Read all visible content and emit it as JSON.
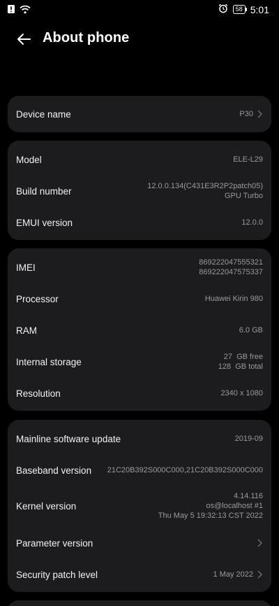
{
  "status_bar": {
    "time": "5:01",
    "battery": "58",
    "icons_left": [
      "alert-icon",
      "wifi-icon"
    ],
    "icons_right": [
      "alarm-icon",
      "battery-icon"
    ]
  },
  "header": {
    "title": "About phone",
    "back_icon": "arrow-left-icon"
  },
  "cards": [
    {
      "rows": [
        {
          "label": "Device name",
          "value": "P30",
          "chevron": true
        }
      ]
    },
    {
      "rows": [
        {
          "label": "Model",
          "value": "ELE-L29"
        },
        {
          "label": "Build number",
          "value_lines": [
            "12.0.0.134(C431E3R2P2patch05)",
            "GPU Turbo"
          ]
        },
        {
          "label": "EMUI version",
          "value": "12.0.0"
        }
      ]
    },
    {
      "rows": [
        {
          "label": "IMEI",
          "value_lines": [
            "869222047555321",
            "869222047575337"
          ]
        },
        {
          "label": "Processor",
          "value": "Huawei Kirin 980"
        },
        {
          "label": "RAM",
          "value": "6.0 GB"
        },
        {
          "label": "Internal storage",
          "value_lines": [
            "27  GB free",
            "128  GB total"
          ]
        },
        {
          "label": "Resolution",
          "value": "2340 x 1080"
        }
      ]
    },
    {
      "rows": [
        {
          "label": "Mainline software update",
          "value": "2019-09"
        },
        {
          "label": "Baseband version",
          "value": "21C20B392S000C000,21C20B392S000C000"
        },
        {
          "label": "Kernel version",
          "value_lines": [
            "4.14.116",
            "os@localhost #1",
            "Thu May 5 19:32:13 CST 2022"
          ]
        },
        {
          "label": "Parameter version",
          "value": "",
          "chevron": true
        },
        {
          "label": "Security patch level",
          "value": "1 May 2022",
          "chevron": true
        }
      ]
    }
  ],
  "colors": {
    "background": "#000000",
    "card": "#1c1c1e",
    "label": "#f2f2f2",
    "value": "#9a9a9a"
  }
}
